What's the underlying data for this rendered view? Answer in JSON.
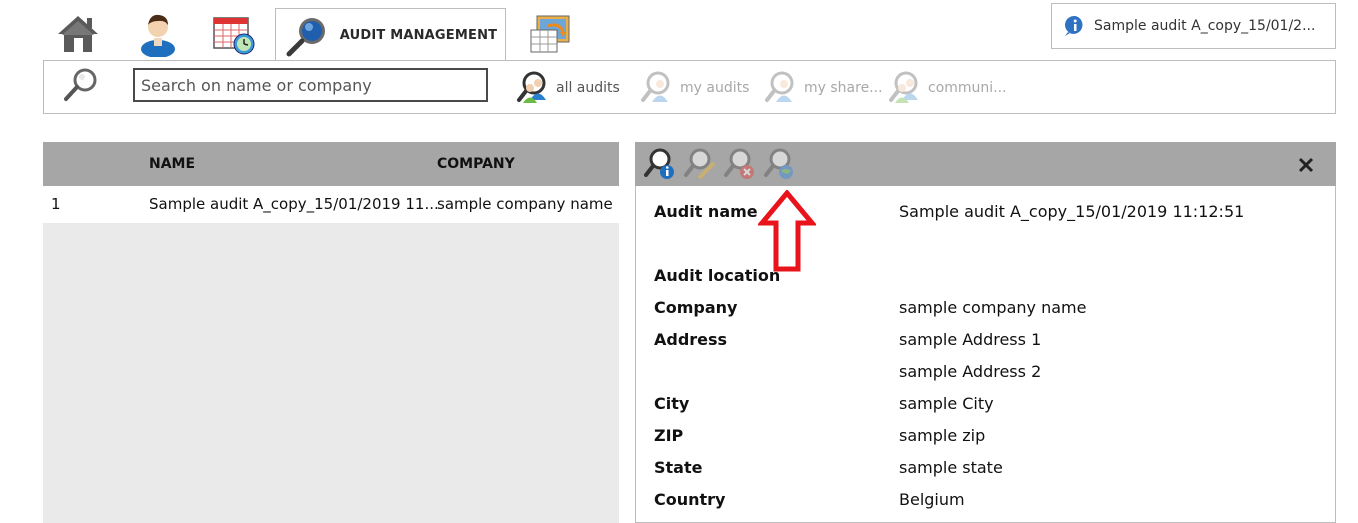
{
  "tabs": {
    "home": "home-icon",
    "user": "user-icon",
    "planning": "calendar-clock-icon",
    "audit_management": "AUDIT MANAGEMENT",
    "sync": "sync-icon"
  },
  "info_box": {
    "text": "Sample audit A_copy_15/01/2..."
  },
  "search": {
    "placeholder": "Search on name or company",
    "value": ""
  },
  "filters": [
    {
      "label": "all audits",
      "active": true
    },
    {
      "label": "my audits",
      "active": false
    },
    {
      "label": "my share...",
      "active": false
    },
    {
      "label": "communi...",
      "active": false
    }
  ],
  "list": {
    "headers": {
      "name": "NAME",
      "company": "COMPANY"
    },
    "rows": [
      {
        "index": "1",
        "name": "Sample audit A_copy_15/01/2019 11...",
        "company": "sample company name"
      }
    ]
  },
  "detail": {
    "toolbar": [
      "audit-info-icon",
      "audit-edit-icon",
      "audit-delete-icon",
      "audit-share-icon"
    ],
    "fields": {
      "audit_name_label": "Audit name",
      "audit_name_value": "Sample audit A_copy_15/01/2019 11:12:51",
      "audit_location_label": "Audit location",
      "company_label": "Company",
      "company_value": "sample company name",
      "address_label": "Address",
      "address_value_1": "sample Address 1",
      "address_value_2": "sample Address 2",
      "city_label": "City",
      "city_value": "sample City",
      "zip_label": "ZIP",
      "zip_value": "sample zip",
      "state_label": "State",
      "state_value": "sample state",
      "country_label": "Country",
      "country_value": "Belgium"
    }
  },
  "colors": {
    "header_gray": "#a6a6a6",
    "panel_gray": "#eaeaea",
    "arrow_red": "#e8131b",
    "accent_blue": "#1f6fbf"
  }
}
